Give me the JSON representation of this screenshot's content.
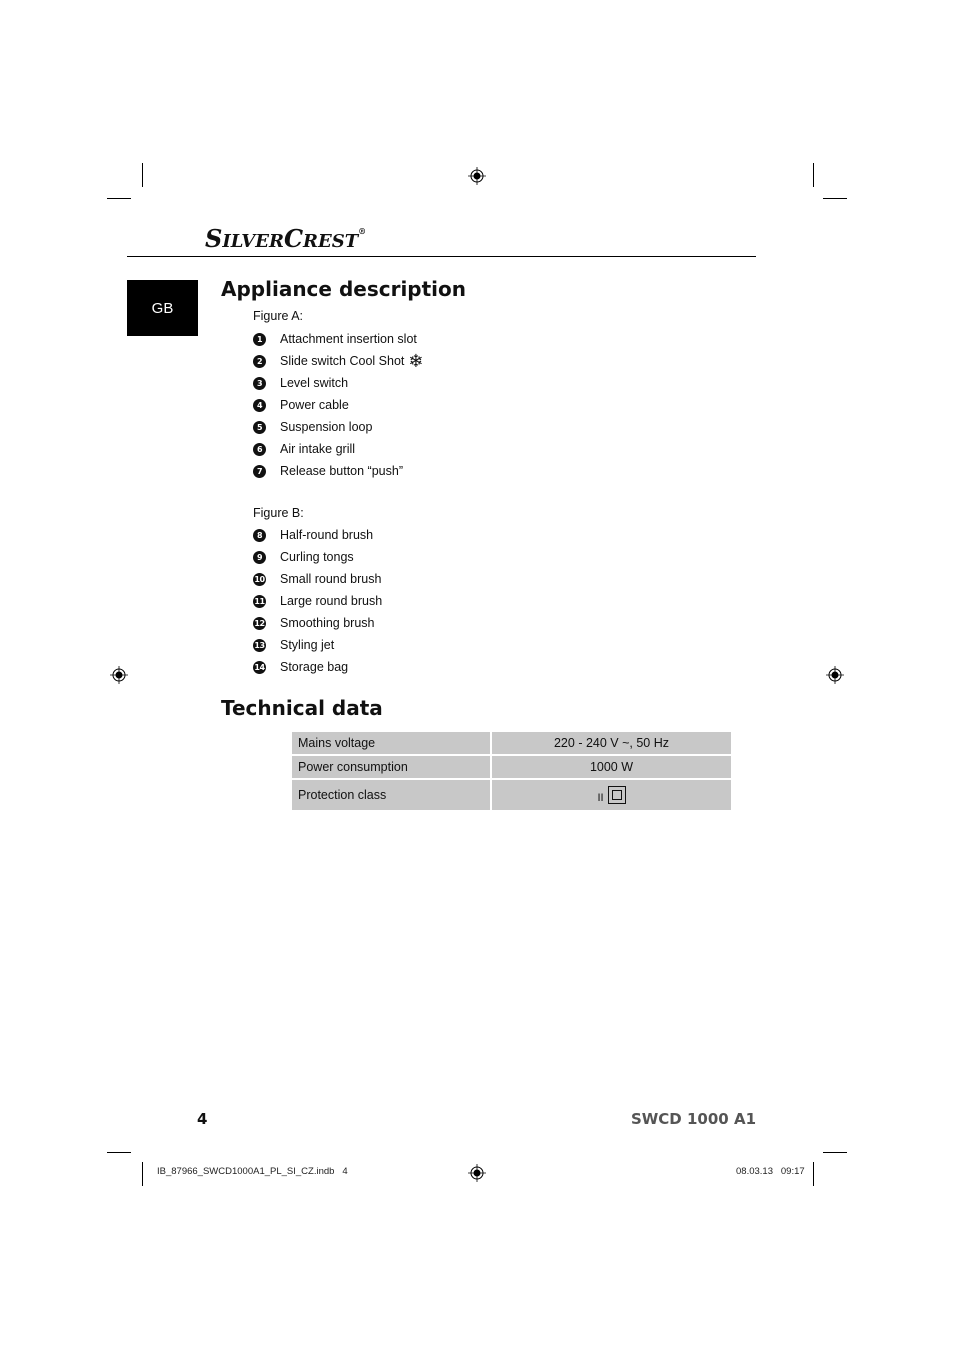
{
  "header": {
    "brand_small_1": "S",
    "brand_rest_1": "ILVER",
    "brand_small_2": "C",
    "brand_rest_2": "REST",
    "brand_mark": "®"
  },
  "language_tab": "GB",
  "appliance_description": {
    "title": "Appliance description",
    "figure_a": {
      "label": "Figure A:",
      "items": [
        {
          "number": "1",
          "label": "Attachment insertion slot"
        },
        {
          "number": "2",
          "label": "Slide switch Cool Shot",
          "icon": "snowflake-icon",
          "glyph": "❄"
        },
        {
          "number": "3",
          "label": "Level switch"
        },
        {
          "number": "4",
          "label": "Power cable"
        },
        {
          "number": "5",
          "label": "Suspension loop"
        },
        {
          "number": "6",
          "label": "Air intake grill"
        },
        {
          "number": "7",
          "label": "Release button “push”"
        }
      ]
    },
    "figure_b": {
      "label": "Figure B:",
      "items": [
        {
          "number": "8",
          "label": "Half-round brush"
        },
        {
          "number": "9",
          "label": "Curling tongs"
        },
        {
          "number": "10",
          "label": "Small round brush"
        },
        {
          "number": "11",
          "label": "Large round brush"
        },
        {
          "number": "12",
          "label": "Smoothing brush"
        },
        {
          "number": "13",
          "label": "Styling jet"
        },
        {
          "number": "14",
          "label": "Storage bag"
        }
      ]
    }
  },
  "technical_data": {
    "title": "Technical data",
    "rows": [
      {
        "key": "Mains voltage",
        "value": "220 - 240 V ~, 50 Hz"
      },
      {
        "key": "Power consumption",
        "value": "1000 W"
      },
      {
        "key": "Protection class",
        "value": "II",
        "icon": "double-insulation-icon"
      }
    ],
    "cell_color": "#c8c8c8"
  },
  "footer": {
    "page_number": "4",
    "model": "SWCD 1000 A1",
    "file_slug": "IB_87966_SWCD1000A1_PL_SI_CZ.indb   4",
    "date_time": "08.03.13   09:17"
  }
}
